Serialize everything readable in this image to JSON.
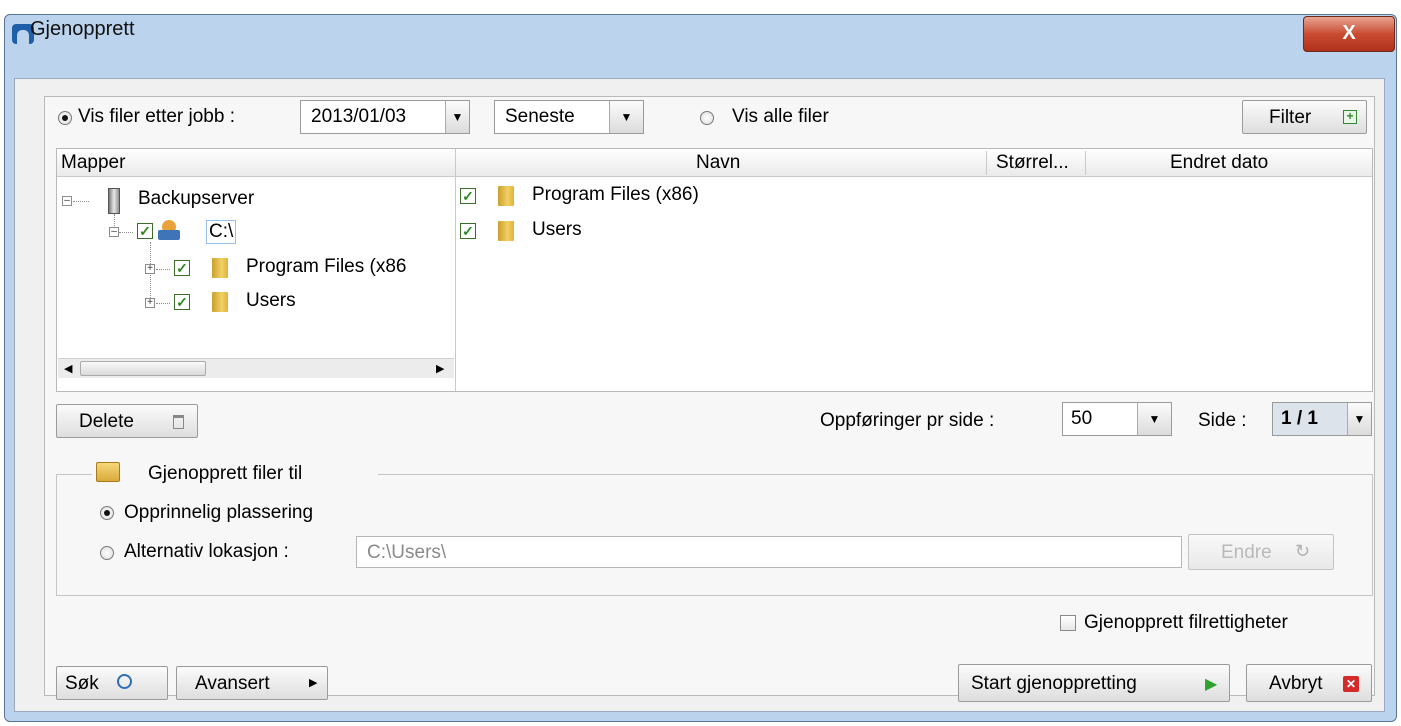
{
  "window": {
    "title": "Gjenopprett",
    "close_label": "X"
  },
  "top": {
    "by_job_label": "Vis filer etter jobb :",
    "job_date": "2013/01/03",
    "version": "Seneste",
    "all_files_label": "Vis alle filer",
    "filter_label": "Filter"
  },
  "tree": {
    "header": "Mapper",
    "server": "Backupserver",
    "drive": "C:\\",
    "items": [
      "Program Files (x86",
      "Users"
    ]
  },
  "files": {
    "columns": [
      "Navn",
      "Størrel...",
      "Endret dato"
    ],
    "rows": [
      {
        "name": "Program Files (x86)"
      },
      {
        "name": "Users"
      }
    ]
  },
  "paging": {
    "delete_label": "Delete",
    "per_page_label": "Oppføringer pr side :",
    "per_page_value": "50",
    "page_label": "Side :",
    "page_value": "1 / 1"
  },
  "restore": {
    "group_label": "Gjenopprett filer til",
    "original_label": "Opprinnelig plassering",
    "alternate_label": "Alternativ lokasjon :",
    "alternate_value": "C:\\Users\\",
    "change_label": "Endre",
    "permissions_label": "Gjenopprett filrettigheter"
  },
  "bottom": {
    "search_label": "Søk",
    "advanced_label": "Avansert",
    "start_label": "Start gjenoppretting",
    "cancel_label": "Avbryt"
  },
  "colors": {
    "title_bar": "#bcd3ee",
    "close": "#c94c32",
    "check": "#2b8a1e",
    "folder": "#f2d064"
  },
  "icons": [
    "app-icon",
    "close-icon",
    "filter-add-icon",
    "server-icon",
    "drive-icon",
    "folder-icon",
    "trash-icon",
    "folder-open-icon",
    "refresh-icon",
    "search-icon",
    "arrow-right-icon",
    "play-icon",
    "cancel-icon"
  ]
}
